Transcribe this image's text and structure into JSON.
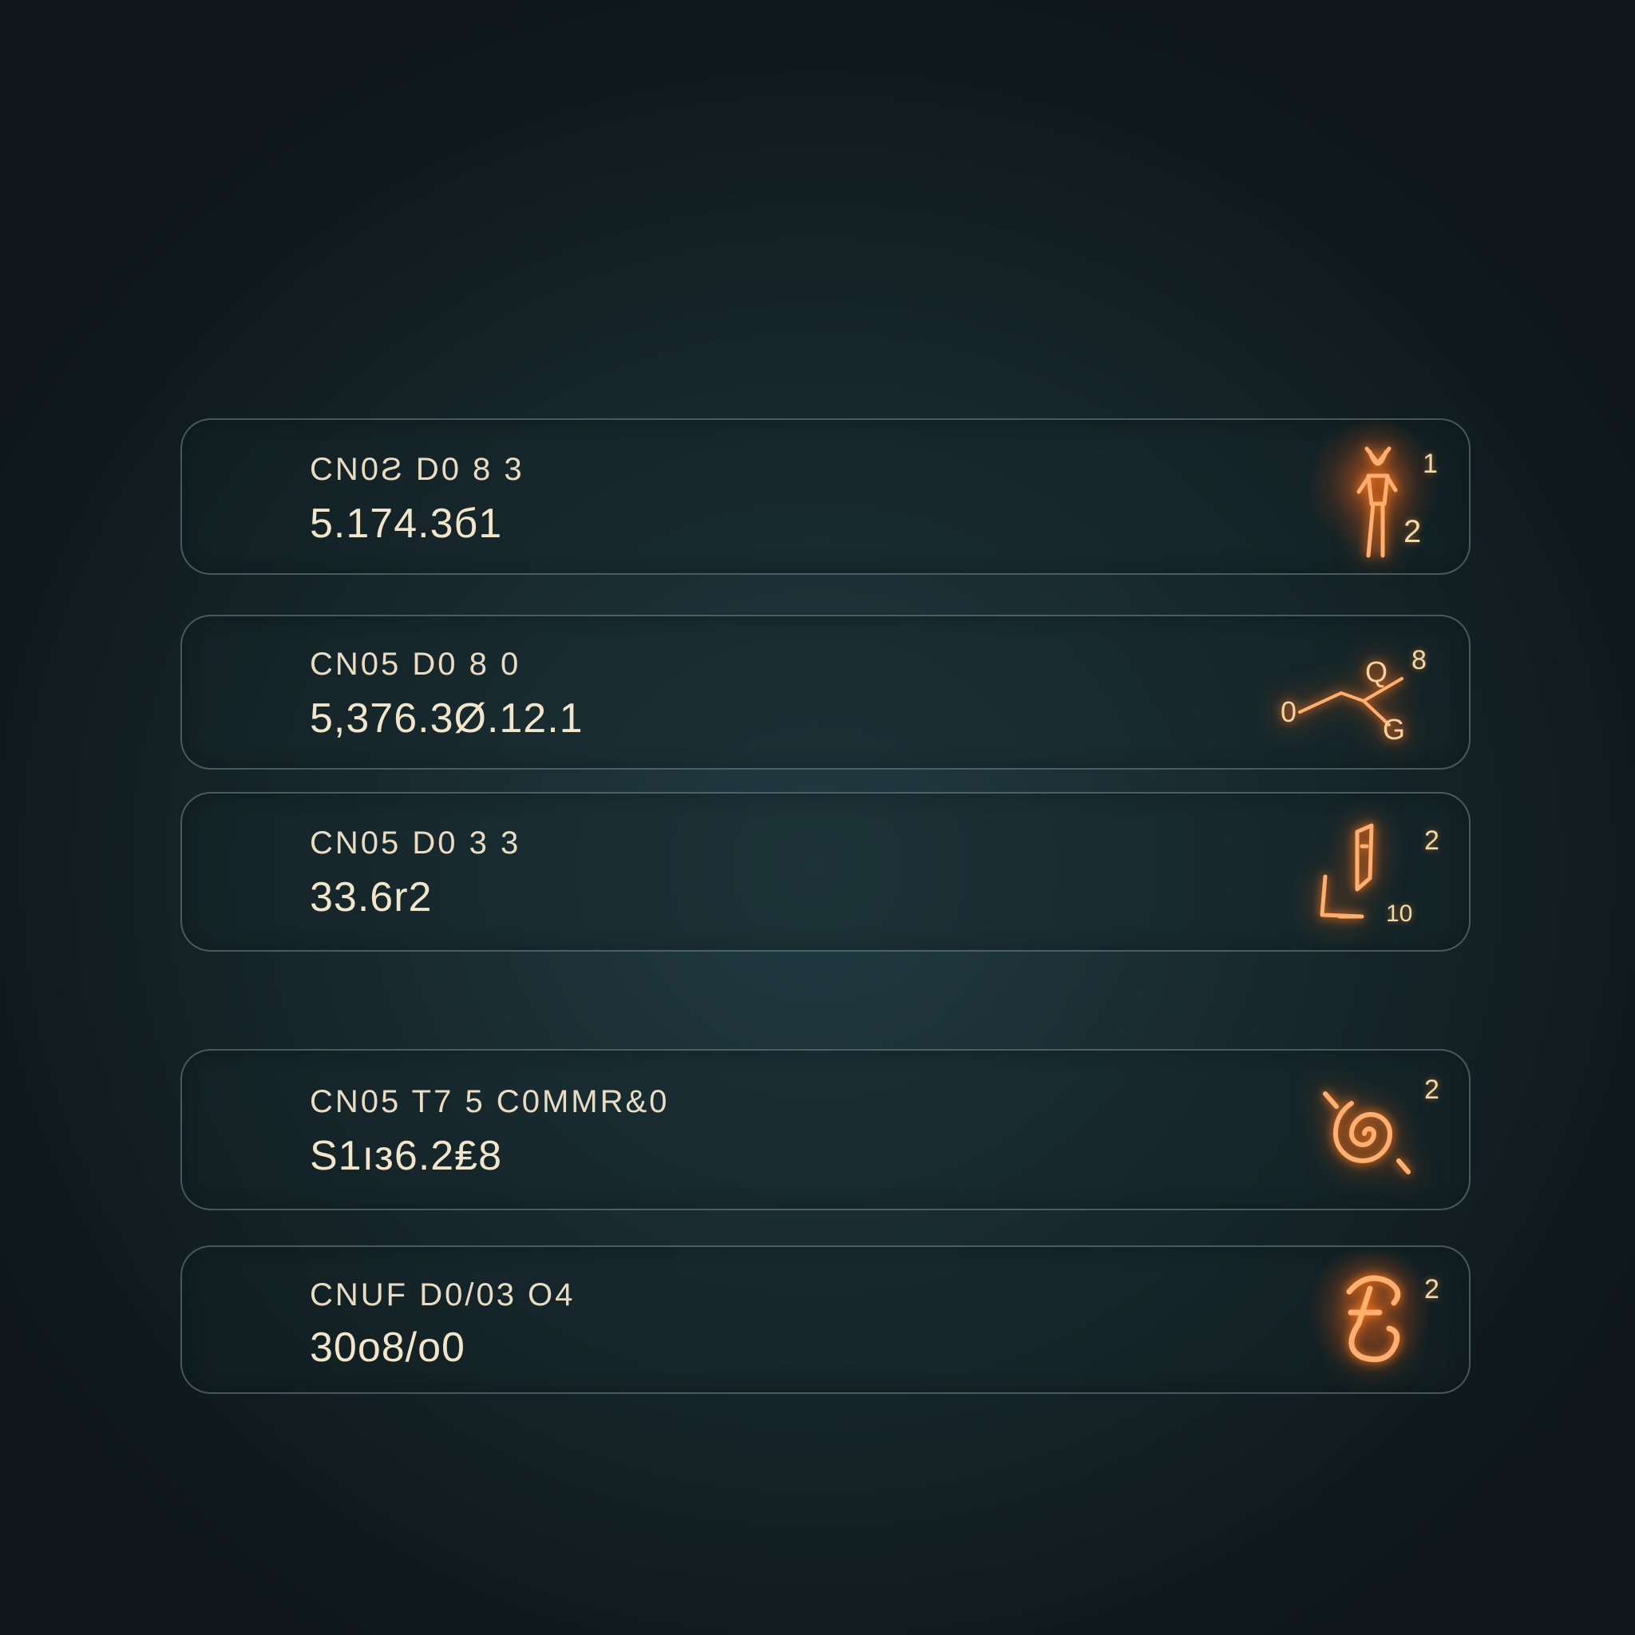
{
  "cards": [
    {
      "title": "CN0Ƨ D0 8 3",
      "value": "5.174.3б1",
      "icon": "person-icon",
      "badge": "1",
      "sub_badge": "2"
    },
    {
      "title": "CN05 D0 8 0",
      "value": "5,376.3Ø.12.1",
      "icon": "network-nodes-icon",
      "badge": "8",
      "node_labels": [
        "0",
        "Q",
        "G"
      ]
    },
    {
      "title": "CN05 D0 3 3",
      "value": "33.6r2",
      "icon": "ruler-bar-icon",
      "badge": "2",
      "sub_badge": "10"
    },
    {
      "title": "CN05 T7 5 C0MMR&0",
      "value": "S1ıз6.2₤8",
      "icon": "spiral-icon",
      "badge": "2"
    },
    {
      "title": "CNUF D0/03 O4",
      "value": "30o8/o0",
      "icon": "glyph-icon",
      "badge": "2"
    }
  ],
  "colors": {
    "accent": "#ff7a1a",
    "text": "#e8dcc3",
    "border": "#8caaaf",
    "background": "#1a2d33"
  }
}
